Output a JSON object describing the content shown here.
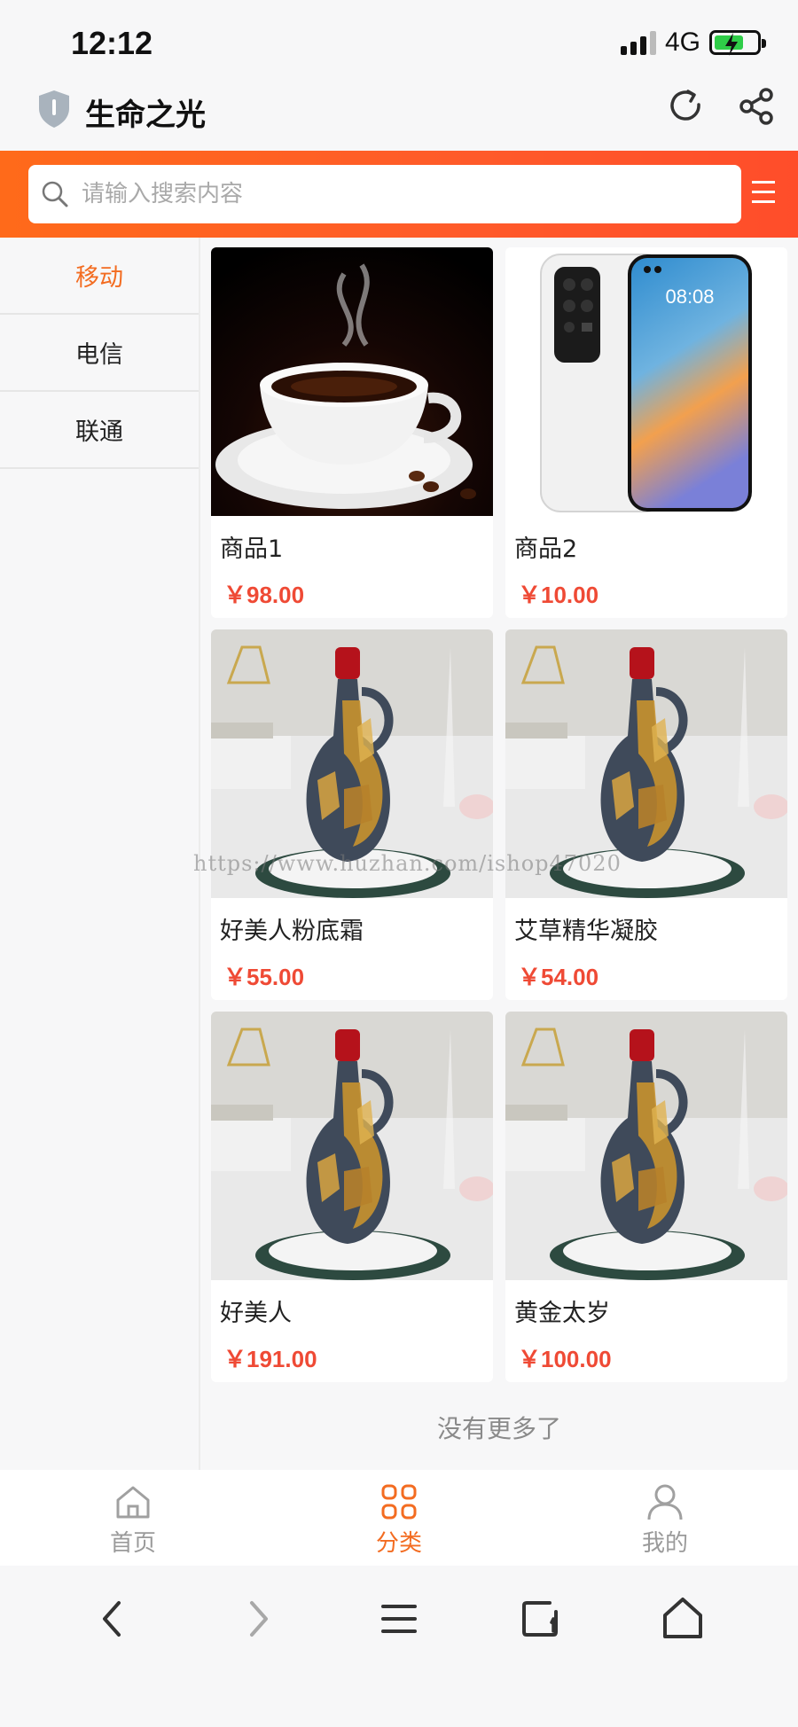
{
  "status_bar": {
    "time": "12:12",
    "network": "4G"
  },
  "browser": {
    "site_title": "生命之光"
  },
  "search": {
    "placeholder": "请输入搜索内容",
    "value": ""
  },
  "categories": [
    {
      "label": "移动",
      "active": true
    },
    {
      "label": "电信",
      "active": false
    },
    {
      "label": "联通",
      "active": false
    }
  ],
  "products": [
    {
      "name": "商品1",
      "price": "￥98.00",
      "image": "coffee-cup"
    },
    {
      "name": "商品2",
      "price": "￥10.00",
      "image": "smartphone"
    },
    {
      "name": "好美人粉底霜",
      "price": "￥55.00",
      "image": "decorative-vase"
    },
    {
      "name": "艾草精华凝胶",
      "price": "￥54.00",
      "image": "decorative-vase"
    },
    {
      "name": "好美人",
      "price": "￥191.00",
      "image": "decorative-vase"
    },
    {
      "name": "黄金太岁",
      "price": "￥100.00",
      "image": "decorative-vase"
    }
  ],
  "phone_image_clock": "08:08",
  "watermark": "https://www.huzhan.com/ishop47020",
  "list_end_text": "没有更多了",
  "tabs": [
    {
      "label": "首页",
      "icon": "home-icon",
      "active": false
    },
    {
      "label": "分类",
      "icon": "category-icon",
      "active": true
    },
    {
      "label": "我的",
      "icon": "user-icon",
      "active": false
    }
  ],
  "colors": {
    "accent": "#f36c21",
    "price": "#ef4a35",
    "header_orange": "#ff5a2a"
  }
}
